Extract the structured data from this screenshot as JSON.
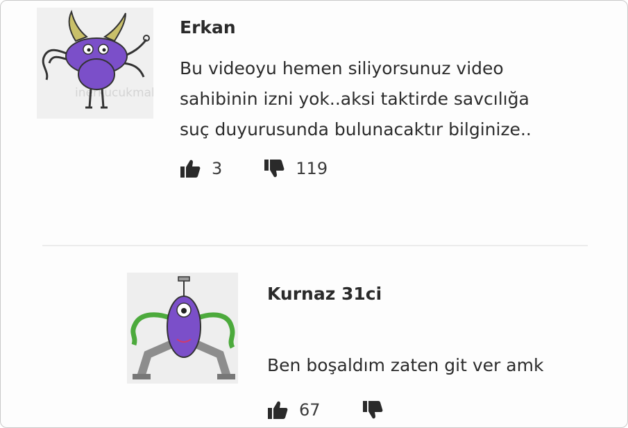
{
  "comments": [
    {
      "author": "Erkan",
      "text_lines": [
        "Bu videoyu hemen siliyorsunuz video",
        "sahibinin izni yok..aksi taktirde savcılığa",
        "suç duyurusunda bulunacaktır bilginize.."
      ],
      "likes": "3",
      "dislikes": "119",
      "avatar_icon": "purple-horned-monster-avatar",
      "avatar_watermark": "inerkucukmaharasbahceli"
    },
    {
      "author": "Kurnaz 31ci",
      "text_lines": [
        "Ben boşaldım zaten git ver amk"
      ],
      "likes": "67",
      "dislikes": "",
      "avatar_icon": "purple-cyclops-alien-avatar"
    }
  ],
  "icons": {
    "like": "thumbs-up-icon",
    "dislike": "thumbs-down-icon"
  },
  "colors": {
    "avatar_purple": "#7b4fc9",
    "avatar_green": "#4caa3c",
    "icon": "#2a2a2a"
  }
}
